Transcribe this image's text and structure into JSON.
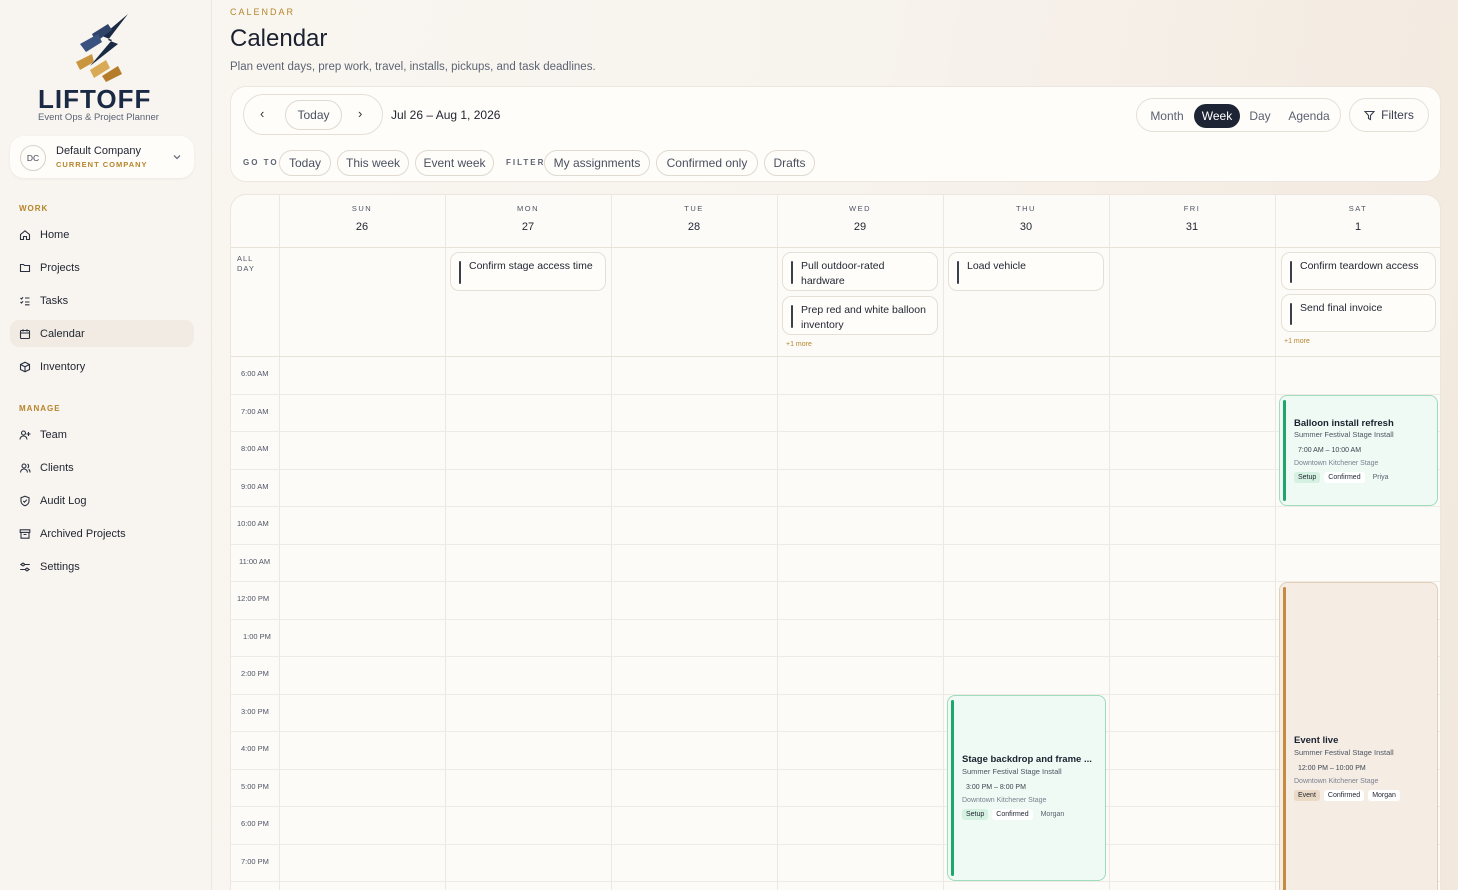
{
  "sidebar": {
    "logo_text": "LIFTOFF",
    "logo_tagline": "Event Ops & Project Planner",
    "company": {
      "initials": "DC",
      "name": "Default Company",
      "role": "CURRENT COMPANY"
    },
    "work_label": "WORK",
    "work_items": [
      {
        "label": "Home",
        "icon": "home-icon"
      },
      {
        "label": "Projects",
        "icon": "folder-icon"
      },
      {
        "label": "Tasks",
        "icon": "list-checks-icon"
      },
      {
        "label": "Calendar",
        "icon": "calendar-icon",
        "active": true
      },
      {
        "label": "Inventory",
        "icon": "package-icon"
      }
    ],
    "manage_label": "MANAGE",
    "manage_items": [
      {
        "label": "Team",
        "icon": "user-plus-icon"
      },
      {
        "label": "Clients",
        "icon": "users-icon"
      },
      {
        "label": "Audit Log",
        "icon": "shield-icon"
      },
      {
        "label": "Archived Projects",
        "icon": "archive-icon"
      },
      {
        "label": "Settings",
        "icon": "sliders-icon"
      }
    ]
  },
  "header": {
    "breadcrumb": "CALENDAR",
    "title": "Calendar",
    "subtitle": "Plan event days, prep work, travel, installs, pickups, and task deadlines."
  },
  "toolbar": {
    "prev": "‹",
    "today": "Today",
    "next": "›",
    "range": "Jul 26 – Aug 1, 2026",
    "views": [
      "Month",
      "Week",
      "Day",
      "Agenda"
    ],
    "active_view": "Week",
    "filters": "Filters",
    "goto_label": "GO TO",
    "goto_items": [
      "Today",
      "This week",
      "Event week"
    ],
    "filter_label": "FILTER",
    "filter_items": [
      "My assignments",
      "Confirmed only",
      "Drafts"
    ]
  },
  "calendar": {
    "days": [
      {
        "dow": "SUN",
        "num": "26"
      },
      {
        "dow": "MON",
        "num": "27"
      },
      {
        "dow": "TUE",
        "num": "28"
      },
      {
        "dow": "WED",
        "num": "29"
      },
      {
        "dow": "THU",
        "num": "30"
      },
      {
        "dow": "FRI",
        "num": "31"
      },
      {
        "dow": "SAT",
        "num": "1"
      }
    ],
    "allday_label": "ALL DAY",
    "allday_events": {
      "mon": [
        "Confirm stage access time"
      ],
      "wed": [
        "Pull outdoor-rated hardware",
        "Prep red and white balloon inventory"
      ],
      "wed_more": "+1 more",
      "thu": [
        "Load vehicle"
      ],
      "sat": [
        "Confirm teardown access",
        "Send final invoice"
      ],
      "sat_more": "+1 more"
    },
    "times": [
      "6:00 AM",
      "7:00 AM",
      "8:00 AM",
      "9:00 AM",
      "10:00 AM",
      "11:00 AM",
      "12:00 PM",
      "1:00 PM",
      "2:00 PM",
      "3:00 PM",
      "4:00 PM",
      "5:00 PM",
      "6:00 PM",
      "7:00 PM"
    ],
    "events": [
      {
        "title": "Balloon install refresh",
        "project": "Summer Festival Stage Install",
        "time": "7:00 AM – 10:00 AM",
        "location": "Downtown Kitchener Stage",
        "tags": [
          "Setup",
          "Confirmed",
          "Priya"
        ],
        "color": "#1ea66b"
      },
      {
        "title": "Stage backdrop and frame ...",
        "project": "Summer Festival Stage Install",
        "time": "3:00 PM – 8:00 PM",
        "location": "Downtown Kitchener Stage",
        "tags": [
          "Setup",
          "Confirmed",
          "Morgan"
        ],
        "color": "#1ea66b"
      },
      {
        "title": "Event live",
        "project": "Summer Festival Stage Install",
        "time": "12:00 PM – 10:00 PM",
        "location": "Downtown Kitchener Stage",
        "tags": [
          "Event",
          "Confirmed",
          "Morgan"
        ],
        "color": "#c68b3e"
      }
    ]
  }
}
